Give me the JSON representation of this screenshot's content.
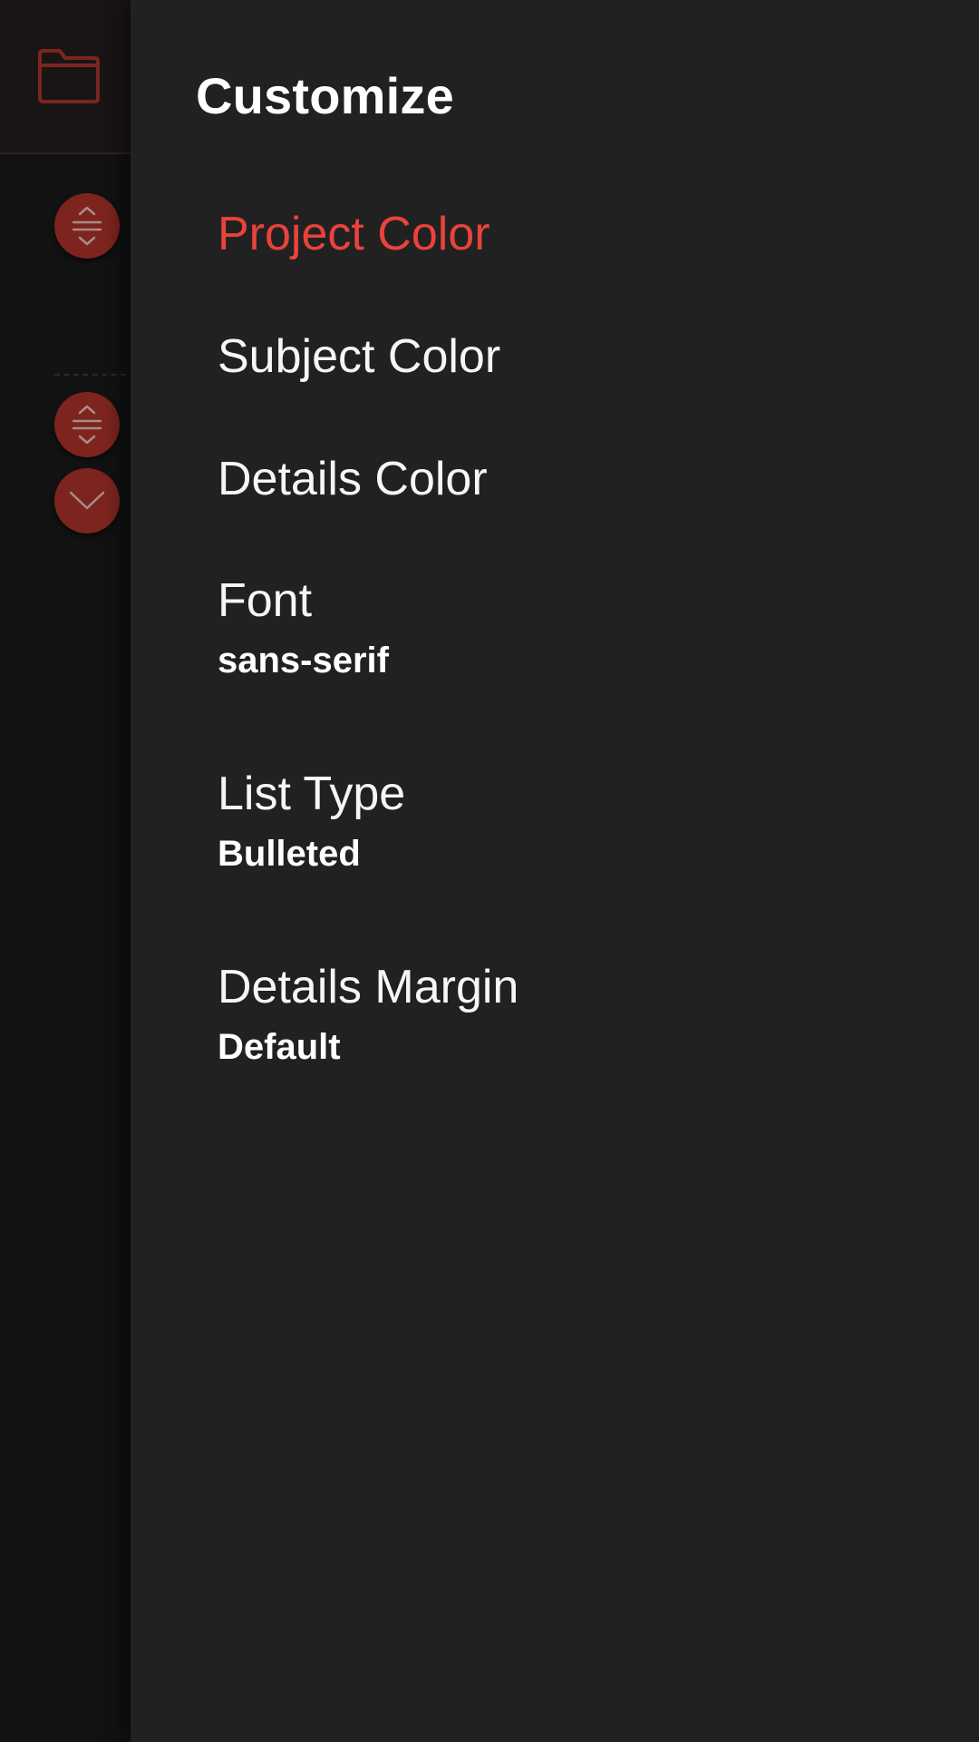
{
  "colors": {
    "accent": "#e8433a",
    "drawer_background": "#212121",
    "fab_background": "#7d241f",
    "text": "#ffffff"
  },
  "background": {
    "folder_icon": "folder-icon",
    "fab_buttons": [
      {
        "icon": "expand-collapse-icon"
      },
      {
        "icon": "expand-collapse-icon"
      },
      {
        "icon": "chevron-down-icon"
      }
    ]
  },
  "drawer": {
    "title": "Customize",
    "items": [
      {
        "label": "Project Color"
      },
      {
        "label": "Subject Color"
      },
      {
        "label": "Details Color"
      },
      {
        "label": "Font",
        "value": "sans-serif"
      },
      {
        "label": "List Type",
        "value": "Bulleted"
      },
      {
        "label": "Details Margin",
        "value": "Default"
      }
    ]
  }
}
